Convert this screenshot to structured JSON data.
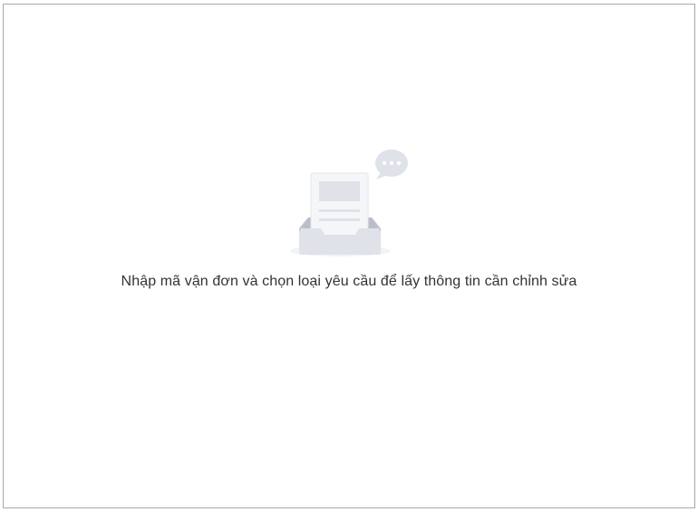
{
  "empty_state": {
    "icon": "inbox-document-chat-icon",
    "message": "Nhập mã vận đơn và chọn loại yêu cầu để lấy thông tin cần chỉnh sửa"
  },
  "colors": {
    "border": "#a9a9a9",
    "text": "#333333",
    "illustration_fill": "#dfe2e8",
    "illustration_dark": "#c5c9d1",
    "bubble": "#dfe2e8"
  }
}
